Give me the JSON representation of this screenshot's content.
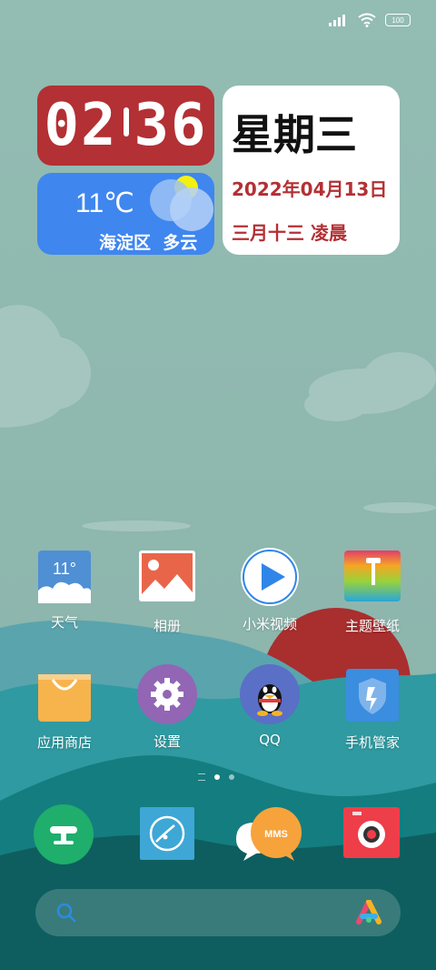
{
  "status_bar": {
    "battery": "100",
    "icons": [
      "signal-icon",
      "wifi-icon",
      "battery-icon"
    ]
  },
  "clock": {
    "hours": "02",
    "minutes": "36"
  },
  "weather": {
    "temp": "11℃",
    "location": "海淀区",
    "condition": "多云",
    "icon": "cloud-sun-icon"
  },
  "date": {
    "weekday": "星期三",
    "date": "2022年04月13日",
    "lunar": "三月十三 凌晨"
  },
  "weather_app": {
    "icon_temp": "11°"
  },
  "apps_row1": [
    {
      "label": "天气",
      "icon": "weather-app-icon"
    },
    {
      "label": "相册",
      "icon": "gallery-icon"
    },
    {
      "label": "小米视频",
      "icon": "video-play-icon"
    },
    {
      "label": "主题壁纸",
      "icon": "themes-icon"
    }
  ],
  "apps_row2": [
    {
      "label": "应用商店",
      "icon": "store-bag-icon"
    },
    {
      "label": "设置",
      "icon": "gear-icon"
    },
    {
      "label": "QQ",
      "icon": "qq-penguin-icon"
    },
    {
      "label": "手机管家",
      "icon": "shield-icon"
    }
  ],
  "dock": [
    {
      "icon": "phone-icon"
    },
    {
      "icon": "browser-icon"
    },
    {
      "icon": "mms-icon",
      "text": "MMS"
    },
    {
      "icon": "camera-icon"
    }
  ],
  "search": {
    "placeholder": "",
    "icons": [
      "search-icon",
      "assistant-icon"
    ]
  },
  "colors": {
    "clock_red": "#b33034",
    "weather_blue": "#3f86ef",
    "sky": "#8fb7ae",
    "sun_red": "#a92e2e"
  }
}
